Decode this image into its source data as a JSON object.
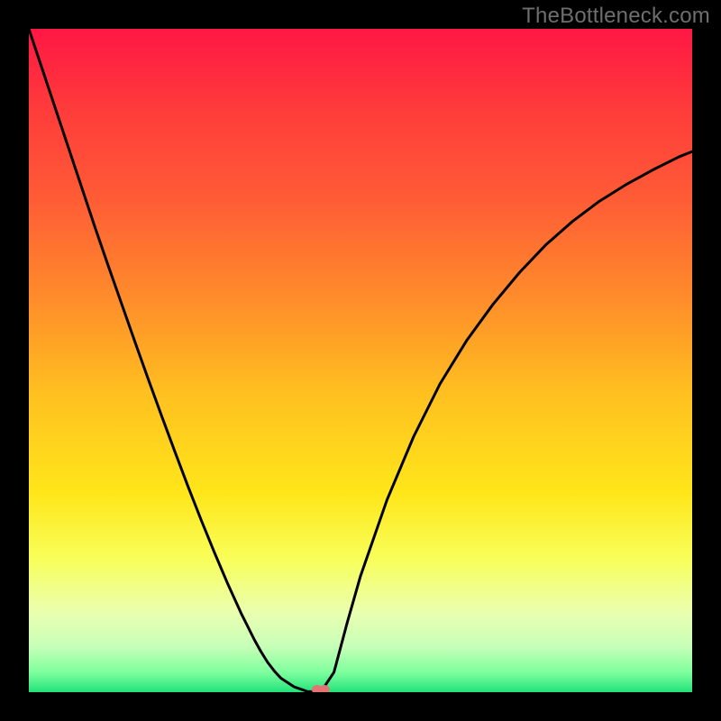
{
  "watermark": "TheBottleneck.com",
  "chart_data": {
    "type": "line",
    "title": "",
    "xlabel": "",
    "ylabel": "",
    "xlim": [
      0,
      100
    ],
    "ylim": [
      0,
      100
    ],
    "grid": false,
    "legend": false,
    "x": [
      0,
      2,
      4,
      6,
      8,
      10,
      12,
      14,
      16,
      18,
      20,
      22,
      24,
      26,
      28,
      30,
      32,
      33,
      34,
      34.5,
      35,
      35.5,
      36,
      37,
      38,
      40,
      42,
      44,
      46,
      48,
      50,
      54,
      58,
      62,
      66,
      70,
      74,
      78,
      82,
      86,
      90,
      94,
      98,
      100
    ],
    "values": [
      100,
      94.0,
      88.0,
      82.0,
      76.0,
      70.0,
      64.2,
      58.5,
      52.8,
      47.2,
      41.7,
      36.3,
      31.0,
      25.9,
      21.0,
      16.3,
      11.9,
      9.9,
      7.9,
      7.0,
      6.1,
      5.3,
      4.5,
      3.2,
      2.1,
      0.8,
      0.1,
      0.0,
      3.0,
      10.5,
      17.5,
      29.0,
      38.5,
      46.5,
      53.0,
      58.5,
      63.3,
      67.5,
      71.0,
      74.0,
      76.5,
      78.7,
      80.7,
      81.5
    ],
    "marker": {
      "x": 44,
      "y": 0,
      "color": "#e57373"
    },
    "gradient_stops": [
      {
        "pos": 0.0,
        "color": "#ff1744"
      },
      {
        "pos": 0.12,
        "color": "#ff3b3b"
      },
      {
        "pos": 0.25,
        "color": "#ff5a36"
      },
      {
        "pos": 0.4,
        "color": "#ff8a2b"
      },
      {
        "pos": 0.55,
        "color": "#ffc020"
      },
      {
        "pos": 0.7,
        "color": "#ffe61a"
      },
      {
        "pos": 0.8,
        "color": "#f8ff5a"
      },
      {
        "pos": 0.88,
        "color": "#eaffb0"
      },
      {
        "pos": 0.93,
        "color": "#c8ffb8"
      },
      {
        "pos": 0.97,
        "color": "#7fff9e"
      },
      {
        "pos": 1.0,
        "color": "#22e27a"
      }
    ]
  }
}
